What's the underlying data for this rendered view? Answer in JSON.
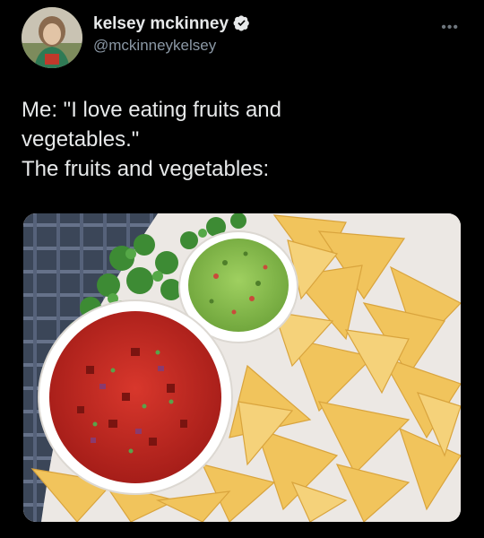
{
  "tweet": {
    "author": {
      "display_name": "kelsey mckinney",
      "handle": "@mckinneykelsey",
      "verified": true
    },
    "more_icon": "more-horizontal-icon",
    "text_lines": [
      "Me: \"I love eating fruits and",
      "vegetables.\"",
      "The fruits and vegetables:"
    ],
    "media": {
      "subject": "salsa-guacamole-tortilla-chips-photo"
    }
  },
  "colors": {
    "background": "#000000",
    "text": "#e7e9ea",
    "secondary_text": "#8b98a5",
    "verified_badge": "#e7e9ea"
  }
}
